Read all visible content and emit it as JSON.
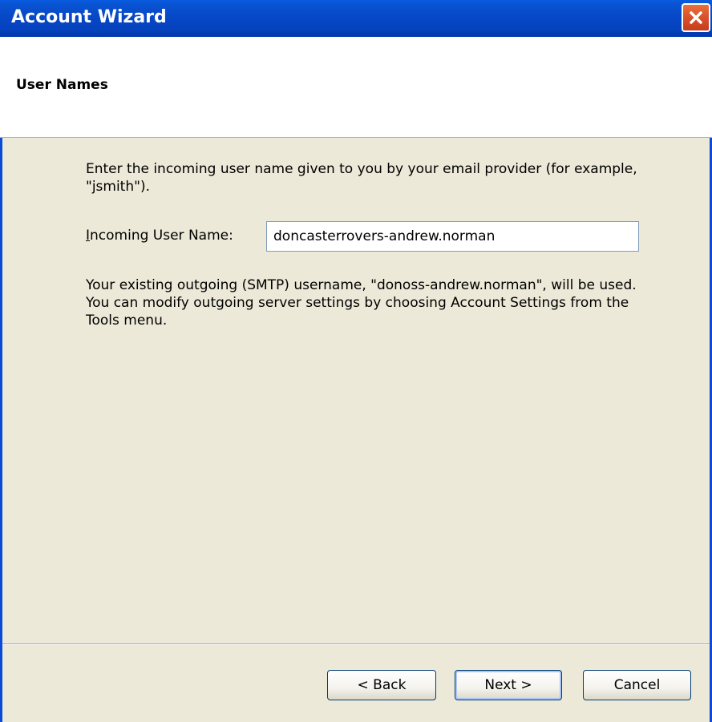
{
  "window": {
    "title": "Account Wizard",
    "close_icon": "close-icon"
  },
  "page": {
    "title": "User Names"
  },
  "content": {
    "description": "Enter the incoming user name given to you by your email provider (for example, \"jsmith\").",
    "incoming_label_mnemonic": "I",
    "incoming_label_rest": "ncoming User Name:",
    "incoming_value": "doncasterrovers-andrew.norman",
    "note": "Your existing outgoing (SMTP) username, \"donoss-andrew.norman\", will be used. You can modify outgoing server settings by choosing Account Settings from the Tools menu."
  },
  "buttons": {
    "back_label": "< Back",
    "next_label": "Next >",
    "cancel_label": "Cancel"
  },
  "colors": {
    "titlebar": "#0647c6",
    "dialog_bg": "#ece9d8",
    "close_button": "#d9512a"
  }
}
